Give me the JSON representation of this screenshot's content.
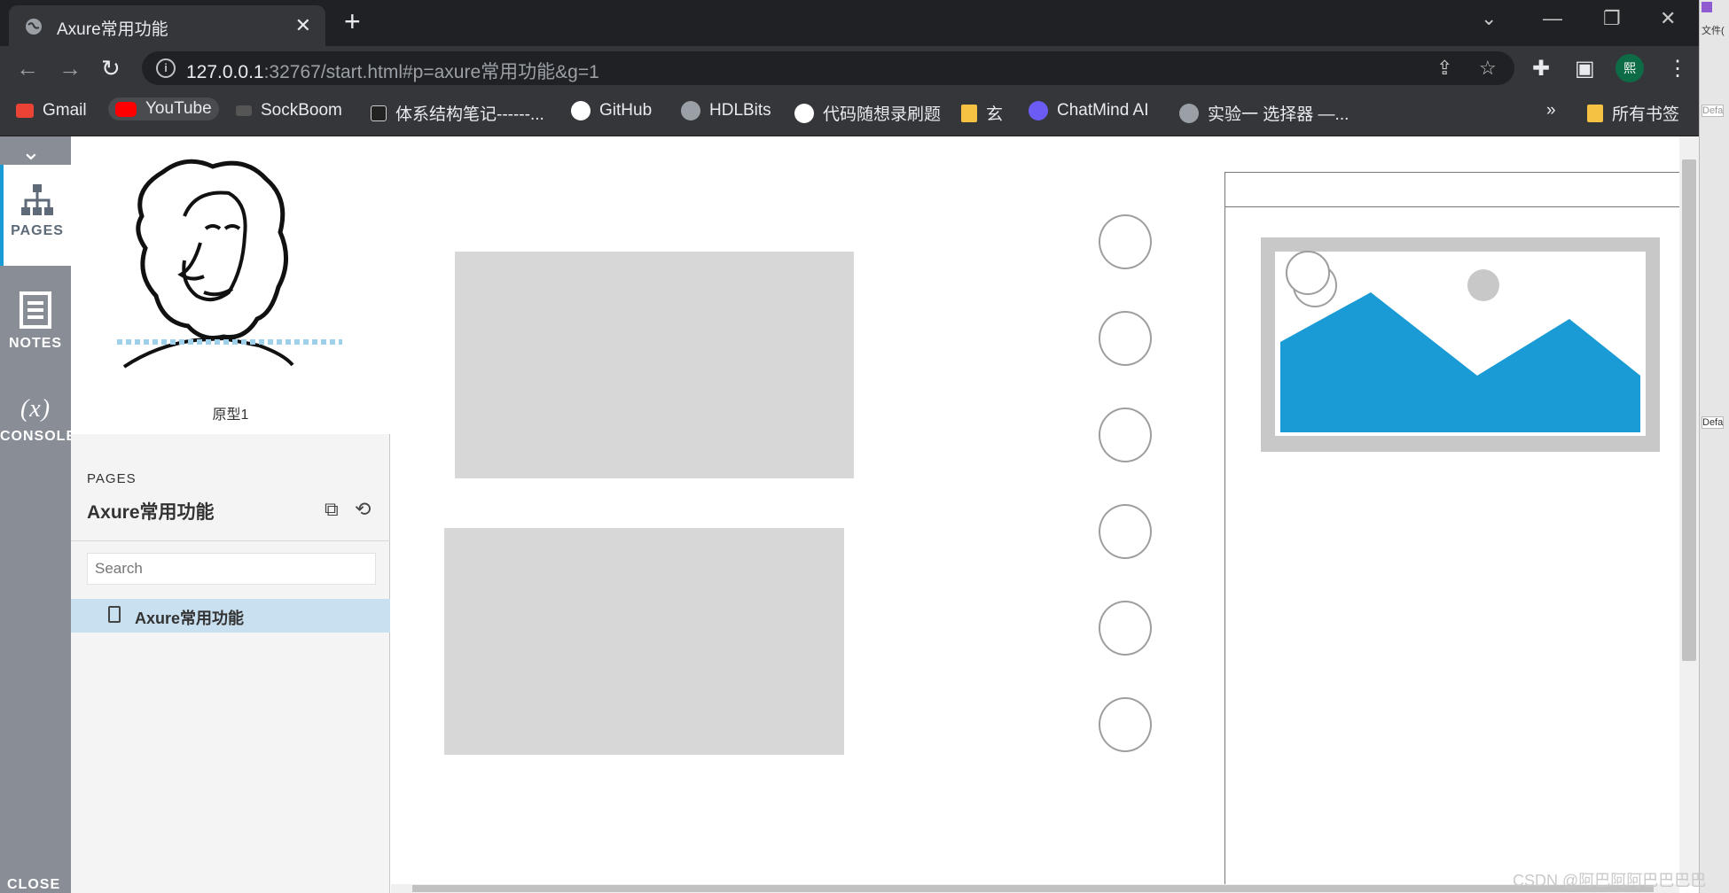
{
  "browser": {
    "tab_title": "Axure常用功能",
    "new_tab": "+",
    "url_host": "127.0.0.1",
    "url_rest": ":32767/start.html#p=axure常用功能&g=1",
    "profile_initial": "熙"
  },
  "bookmarks": [
    {
      "label": "Gmail",
      "color": "#ea4335"
    },
    {
      "label": "YouTube",
      "color": "#ff0000"
    },
    {
      "label": "SockBoom",
      "color": "#555555"
    },
    {
      "label": "体系结构笔记------...",
      "color": "#222222"
    },
    {
      "label": "GitHub",
      "color": "#ffffff"
    },
    {
      "label": "HDLBits",
      "color": "#9aa0a6"
    },
    {
      "label": "代码随想录刷题",
      "color": "#ffffff"
    },
    {
      "label": "玄",
      "color": "#f6c244"
    },
    {
      "label": "ChatMind AI",
      "color": "#6b5cf6"
    },
    {
      "label": "实验一 选择器 —...",
      "color": "#9aa0a6"
    }
  ],
  "bookmarks_more": "»",
  "bookmarks_folder": "所有书签",
  "rail": {
    "pages": "PAGES",
    "notes": "NOTES",
    "console_glyph": "(x)",
    "console": "CONSOLE",
    "close": "CLOSE"
  },
  "panel": {
    "prototype_name": "原型1",
    "pages_label": "PAGES",
    "project_title": "Axure常用功能",
    "search_placeholder": "Search",
    "pages": [
      {
        "label": "Axure常用功能",
        "selected": true
      }
    ]
  },
  "colors": {
    "accent": "#1a9bd6",
    "placeholder_gray": "#d7d7d7",
    "image_blue": "#1a9bd6"
  },
  "watermark": "CSDN @阿巴阿阿巴巴巴巴",
  "strip_labels": [
    "文件(",
    "Defa",
    "Defa"
  ]
}
